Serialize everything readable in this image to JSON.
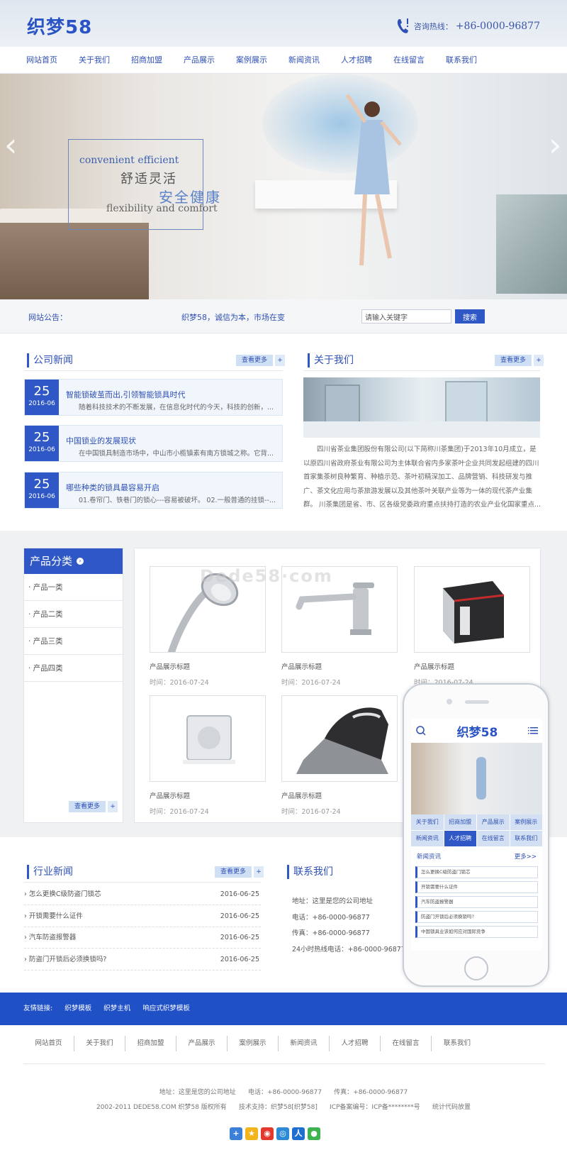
{
  "header": {
    "logo": "织梦58",
    "hotline_label": "咨询热线：",
    "hotline_number": "+86-0000-96877"
  },
  "nav": [
    "网站首页",
    "关于我们",
    "招商加盟",
    "产品展示",
    "案例展示",
    "新闻资讯",
    "人才招聘",
    "在线留言",
    "联系我们"
  ],
  "banner": {
    "en1": "convenient efficient",
    "cn1": "舒适灵活",
    "cn2": "安全健康",
    "en2": "flexibility and comfort",
    "prev": "‹",
    "next": "›"
  },
  "notice": {
    "label": "网站公告：",
    "text": "织梦58，诚信为本，市场在变",
    "search_placeholder": "请输入关键字",
    "search_button": "搜索"
  },
  "company_news": {
    "title": "公司新闻",
    "more": "查看更多",
    "plus": "+",
    "items": [
      {
        "day": "25",
        "ym": "2016-06",
        "title": "智能锁破茧而出,引领智能锁具时代",
        "summary": "随着科技技术的不断发展，在信息化时代的今天，科技的创新，..."
      },
      {
        "day": "25",
        "ym": "2016-06",
        "title": "中国锁业的发展现状",
        "summary": "在中国锁具制造市场中，中山市小榄镇素有南方锁城之称。它背..."
      },
      {
        "day": "25",
        "ym": "2016-06",
        "title": "哪些种类的锁具最容易开启",
        "summary": "01.卷帘门、铁巷门的锁心---容易被破坏。 02.一般普通的挂锁--..."
      }
    ]
  },
  "about": {
    "title": "关于我们",
    "more": "查看更多",
    "plus": "+",
    "text": "四川省茶业集团股份有限公司(以下简称川茶集团)于2013年10月成立，是以原四川省政府茶业有限公司为主体联合省内多家茶叶企业共同发起组建的四川首家集茶树良种繁育、种植示范、茶叶初精深加工、品牌营销、科技研发与推广、茶文化应用与茶旅游发展以及其他茶叶关联产业等为一体的现代茶产业集群。 川茶集团是省、市、区各级党委政府重点扶持打造的农业产业化国家重点..."
  },
  "products": {
    "cat_title": "产品分类",
    "cat_icon": "›",
    "categories": [
      "· 产品一类",
      "· 产品二类",
      "· 产品三类",
      "· 产品四类"
    ],
    "more": "查看更多",
    "plus": "+",
    "watermark": "Dede58·com",
    "items": [
      {
        "title": "产品展示标题",
        "time": "时间：2016-07-24",
        "image": "shower-head"
      },
      {
        "title": "产品展示标题",
        "time": "时间：2016-07-24",
        "image": "faucet"
      },
      {
        "title": "产品展示标题",
        "time": "时间：2016-07-24",
        "image": "toaster"
      },
      {
        "title": "产品展示标题",
        "time": "时间：2016-07-24",
        "image": "square-shower"
      },
      {
        "title": "产品展示标题",
        "time": "时间：2016-07-24",
        "image": "iron"
      }
    ]
  },
  "industry_news": {
    "title": "行业新闻",
    "more": "查看更多",
    "plus": "+",
    "items": [
      {
        "title": "› 怎么更换C级防盗门锁芯",
        "date": "2016-06-25"
      },
      {
        "title": "› 开锁需要什么证件",
        "date": "2016-06-25"
      },
      {
        "title": "› 汽车防盗报警器",
        "date": "2016-06-25"
      },
      {
        "title": "› 防盗门开锁后必须换锁吗?",
        "date": "2016-06-25"
      }
    ]
  },
  "contact": {
    "title": "联系我们",
    "lines": [
      "地址：这里是您的公司地址",
      "电话：+86-0000-96877",
      "传真：+86-0000-96877",
      "24小时热线电话：+86-0000-96877"
    ]
  },
  "phone_mockup": {
    "logo": "织梦58",
    "grid": [
      "关于我们",
      "招商加盟",
      "产品展示",
      "案例展示",
      "新闻资讯",
      "人才招聘",
      "在线留言",
      "联系我们"
    ],
    "news_title": "新闻资讯",
    "news_more": "更多>>",
    "news": [
      "怎么更换C级防盗门锁芯",
      "开锁需要什么证件",
      "汽车防盗报警器",
      "防盗门开锁后必须换锁吗?",
      "中国锁具业该如何应对国际竞争"
    ]
  },
  "footer": {
    "links_label": "友情链接:",
    "links": [
      "织梦模板",
      "织梦主机",
      "响应式织梦模板"
    ],
    "nav": [
      "网站首页",
      "关于我们",
      "招商加盟",
      "产品展示",
      "案例展示",
      "新闻资讯",
      "人才招聘",
      "在线留言",
      "联系我们"
    ],
    "info1": "地址：这里是您的公司地址      电话：+86-0000-96877      传真：+86-0000-96877",
    "info2": "2002-2011 DEDE58.COM 织梦58 版权所有      技术支持：织梦58[织梦58]      ICP备案编号：ICP备********号      统计代码放置",
    "share_icons": [
      "plus-share-icon",
      "qzone-icon",
      "weibo-icon",
      "tencent-weibo-icon",
      "renren-icon",
      "wechat-icon"
    ],
    "share_colors": [
      "#3a7fd8",
      "#f3b51b",
      "#e5382d",
      "#2d8ad6",
      "#1f6fd1",
      "#3fb34f"
    ]
  },
  "colors": {
    "accent": "#2f58c6",
    "footer_band": "#2050c6"
  }
}
